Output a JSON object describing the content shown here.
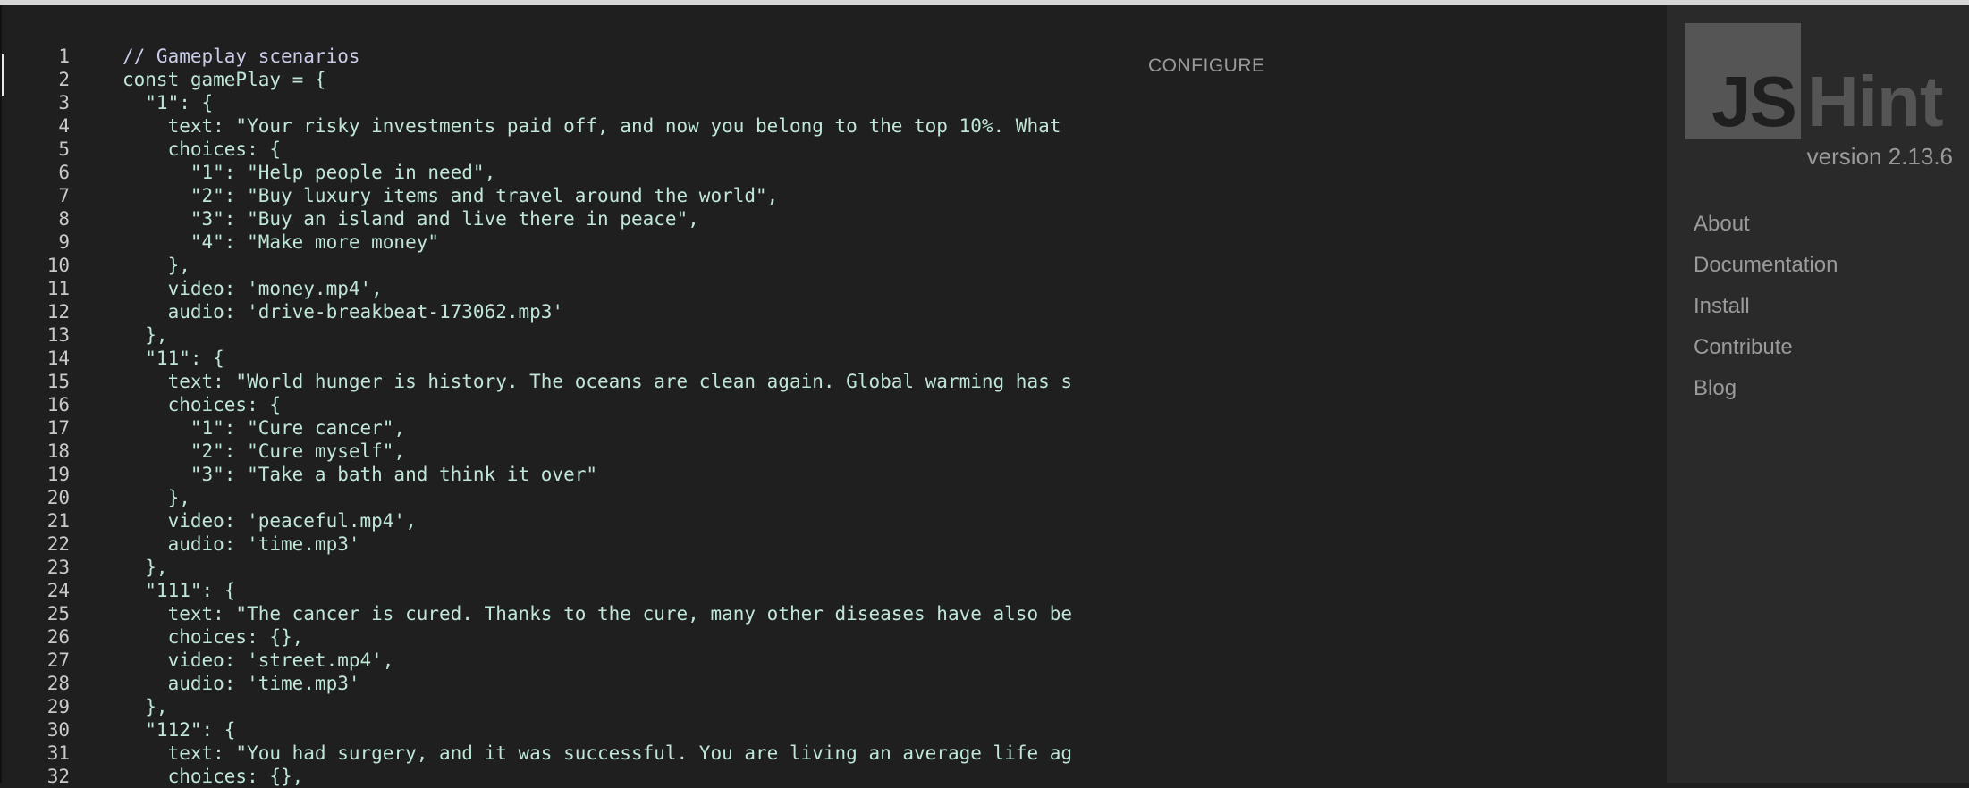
{
  "editor": {
    "configure_label": "CONFIGURE",
    "lines": [
      {
        "n": "1",
        "text": "// Gameplay scenarios",
        "kind": "comment"
      },
      {
        "n": "2",
        "text": "const gamePlay = {",
        "kind": "code"
      },
      {
        "n": "3",
        "text": "  \"1\": {",
        "kind": "code"
      },
      {
        "n": "4",
        "text": "    text: \"Your risky investments paid off, and now you belong to the top 10%. What",
        "kind": "code"
      },
      {
        "n": "5",
        "text": "    choices: {",
        "kind": "code"
      },
      {
        "n": "6",
        "text": "      \"1\": \"Help people in need\",",
        "kind": "code"
      },
      {
        "n": "7",
        "text": "      \"2\": \"Buy luxury items and travel around the world\",",
        "kind": "code"
      },
      {
        "n": "8",
        "text": "      \"3\": \"Buy an island and live there in peace\",",
        "kind": "code"
      },
      {
        "n": "9",
        "text": "      \"4\": \"Make more money\"",
        "kind": "code"
      },
      {
        "n": "10",
        "text": "    },",
        "kind": "code"
      },
      {
        "n": "11",
        "text": "    video: 'money.mp4',",
        "kind": "code"
      },
      {
        "n": "12",
        "text": "    audio: 'drive-breakbeat-173062.mp3'",
        "kind": "code"
      },
      {
        "n": "13",
        "text": "  },",
        "kind": "code"
      },
      {
        "n": "14",
        "text": "  \"11\": {",
        "kind": "code"
      },
      {
        "n": "15",
        "text": "    text: \"World hunger is history. The oceans are clean again. Global warming has s",
        "kind": "code"
      },
      {
        "n": "16",
        "text": "    choices: {",
        "kind": "code"
      },
      {
        "n": "17",
        "text": "      \"1\": \"Cure cancer\",",
        "kind": "code"
      },
      {
        "n": "18",
        "text": "      \"2\": \"Cure myself\",",
        "kind": "code"
      },
      {
        "n": "19",
        "text": "      \"3\": \"Take a bath and think it over\"",
        "kind": "code"
      },
      {
        "n": "20",
        "text": "    },",
        "kind": "code"
      },
      {
        "n": "21",
        "text": "    video: 'peaceful.mp4',",
        "kind": "code"
      },
      {
        "n": "22",
        "text": "    audio: 'time.mp3'",
        "kind": "code"
      },
      {
        "n": "23",
        "text": "  },",
        "kind": "code"
      },
      {
        "n": "24",
        "text": "  \"111\": {",
        "kind": "code"
      },
      {
        "n": "25",
        "text": "    text: \"The cancer is cured. Thanks to the cure, many other diseases have also be",
        "kind": "code"
      },
      {
        "n": "26",
        "text": "    choices: {},",
        "kind": "code"
      },
      {
        "n": "27",
        "text": "    video: 'street.mp4',",
        "kind": "code"
      },
      {
        "n": "28",
        "text": "    audio: 'time.mp3'",
        "kind": "code"
      },
      {
        "n": "29",
        "text": "  },",
        "kind": "code"
      },
      {
        "n": "30",
        "text": "  \"112\": {",
        "kind": "code"
      },
      {
        "n": "31",
        "text": "    text: \"You had surgery, and it was successful. You are living an average life ag",
        "kind": "code"
      },
      {
        "n": "32",
        "text": "    choices: {},",
        "kind": "code"
      }
    ]
  },
  "sidebar": {
    "logo_js": "JS",
    "logo_hint": "Hint",
    "version": "version 2.13.6",
    "nav": [
      {
        "label": "About",
        "icon": ""
      },
      {
        "label": "Documentation",
        "icon": ""
      },
      {
        "label": "Install",
        "icon": ""
      },
      {
        "label": "Contribute",
        "icon": ""
      },
      {
        "label": "Blog",
        "icon": ""
      }
    ]
  },
  "colors": {
    "editor_bg": "#1f1f1f",
    "sidebar_bg": "#2a2a2a",
    "code_text": "#bfe6d6",
    "comment_text": "#c8cbe8",
    "muted_text": "#9a9a9a"
  }
}
